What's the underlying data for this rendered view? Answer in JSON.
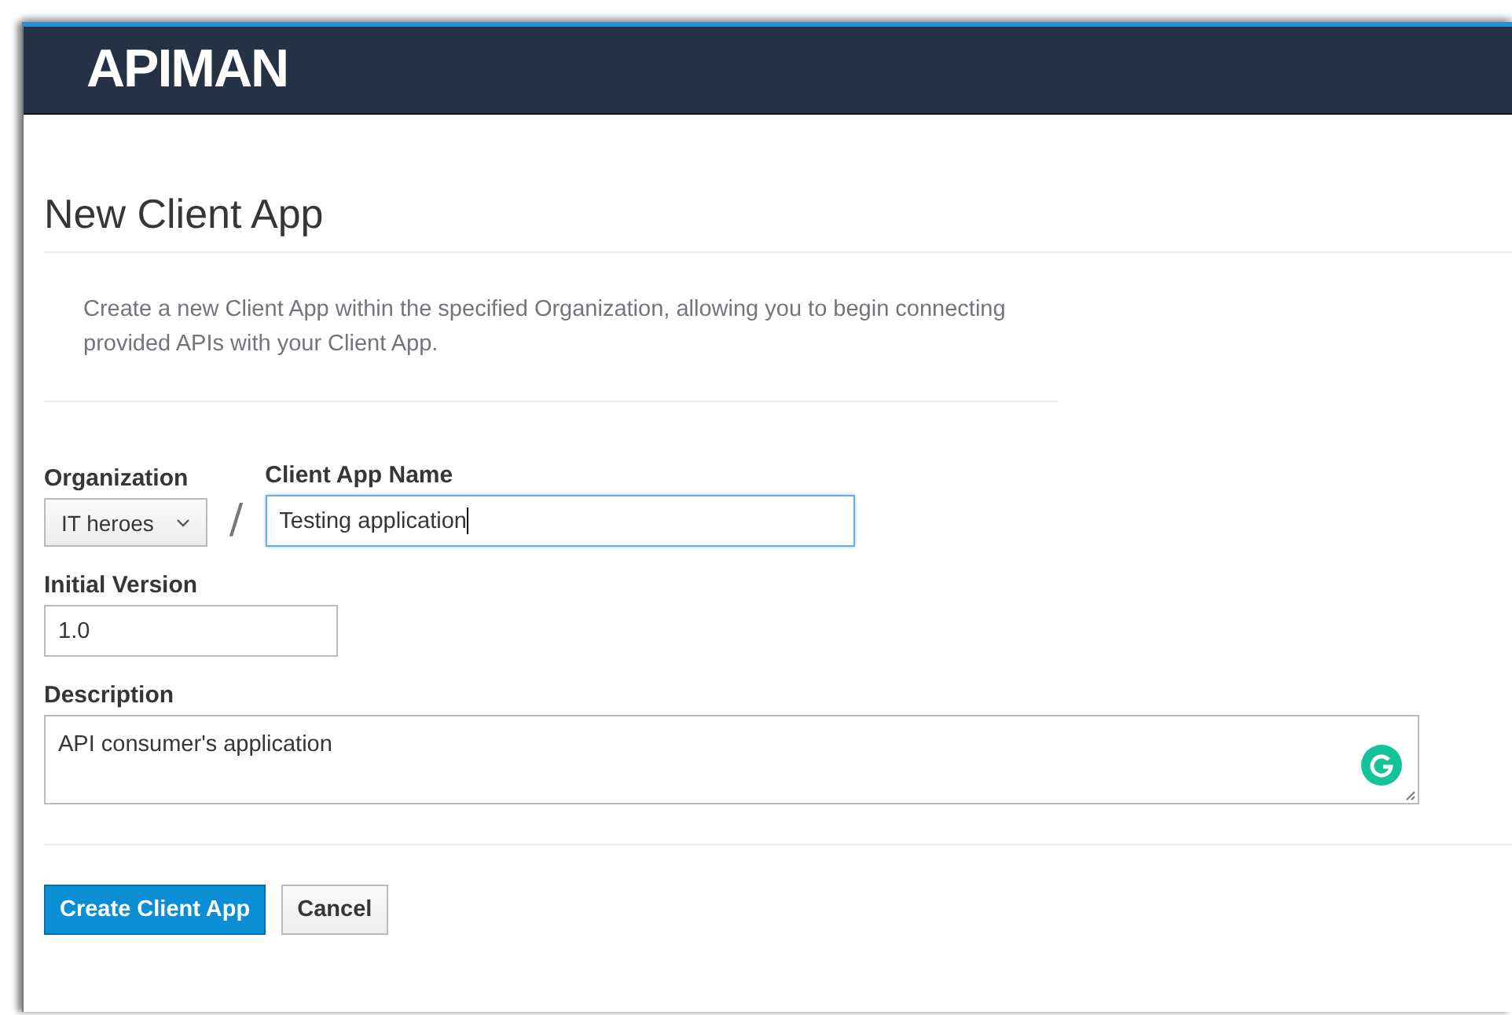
{
  "header": {
    "logo": "APIMAN"
  },
  "page": {
    "title": "New Client App",
    "intro": "Create a new Client App within the specified Organization, allowing you to begin connecting provided APIs with your Client App."
  },
  "form": {
    "organization": {
      "label": "Organization",
      "value": "IT heroes"
    },
    "separator": "/",
    "name": {
      "label": "Client App Name",
      "value": "Testing application",
      "focused": true
    },
    "version": {
      "label": "Initial Version",
      "value": "1.0"
    },
    "description": {
      "label": "Description",
      "value": "API consumer's application"
    }
  },
  "buttons": [
    {
      "label": "Create Client App",
      "kind": "primary"
    },
    {
      "label": "Cancel",
      "kind": "default"
    }
  ]
}
